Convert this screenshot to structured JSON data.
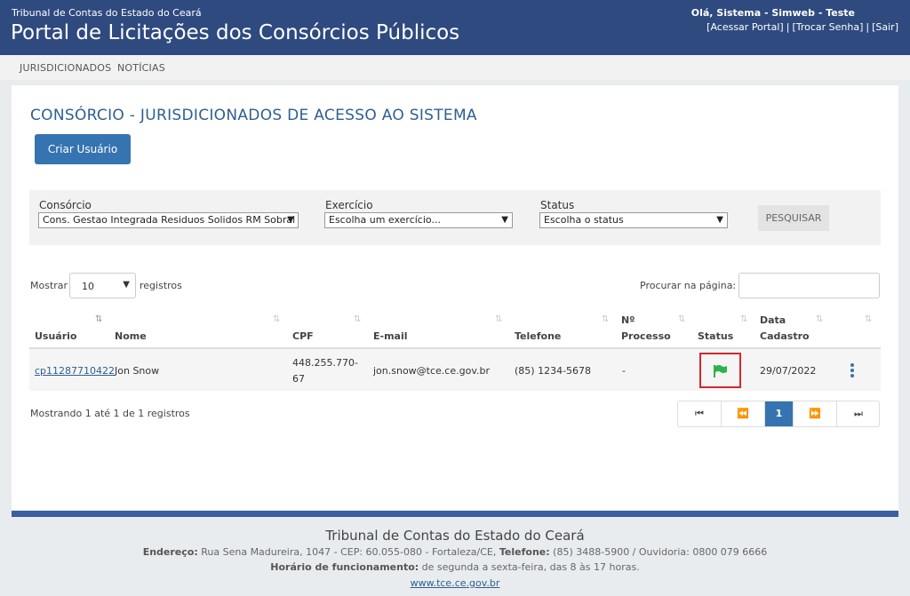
{
  "header": {
    "org": "Tribunal de Contas do Estado do Ceará",
    "title": "Portal de Licitações dos Consórcios Públicos",
    "greeting": "Olá, Sistema - Simweb - Teste",
    "links": [
      "[Acessar Portal]",
      "[Trocar Senha]",
      "[Sair]"
    ],
    "separator": "|"
  },
  "nav": {
    "items": [
      "JURISDICIONADOS",
      "NOTÍCIAS"
    ]
  },
  "main": {
    "title": "CONSÓRCIO - JURISDICIONADOS DE ACESSO AO SISTEMA",
    "create_label": "Criar Usuário"
  },
  "filters": {
    "consorcio_label": "Consórcio",
    "consorcio_value": "Cons. Gestao Integrada Residuos Solidos RM Sobral",
    "exercicio_label": "Exercício",
    "exercicio_value": "Escolha um exercício...",
    "status_label": "Status",
    "status_value": "Escolha o status",
    "search_label": "PESQUISAR"
  },
  "table_controls": {
    "show_label": "Mostrar",
    "show_value": "10",
    "show_suffix": "registros",
    "search_label": "Procurar na página:"
  },
  "table": {
    "headers": [
      "Usuário",
      "Nome",
      "CPF",
      "E-mail",
      "Telefone",
      "Nº",
      "Processo",
      "Status",
      "Data",
      "Cadastro"
    ],
    "rows": [
      {
        "usuario": "cp11287710422",
        "nome": "Jon Snow",
        "cpf_line1": "448.255.770-",
        "cpf_line2": "67",
        "email": "jon.snow@tce.ce.gov.br",
        "telefone": "(85) 1234-5678",
        "processo": "-",
        "status_icon": "flag-icon",
        "data": "29/07/2022"
      }
    ]
  },
  "info": "Mostrando 1 até 1 de 1 registros",
  "pagination": {
    "current": "1"
  },
  "footer": {
    "title": "Tribunal de Contas do Estado do Ceará",
    "address_label": "Endereço:",
    "address": "Rua Sena Madureira, 1047 - CEP: 60.055-080 - Fortaleza/CE,",
    "phone_label": "Telefone:",
    "phone": "(85) 3488-5900 / Ouvidoria: 0800 079 6666",
    "hours_label": "Horário de funcionamento:",
    "hours": "de segunda a sexta-feira, das 8 às 17 horas.",
    "site": "www.tce.ce.gov.br"
  },
  "colors": {
    "header": "#2f4a7f",
    "accent": "#3574b0",
    "status_flag": "#2db34a",
    "status_highlight": "#d9252a"
  }
}
